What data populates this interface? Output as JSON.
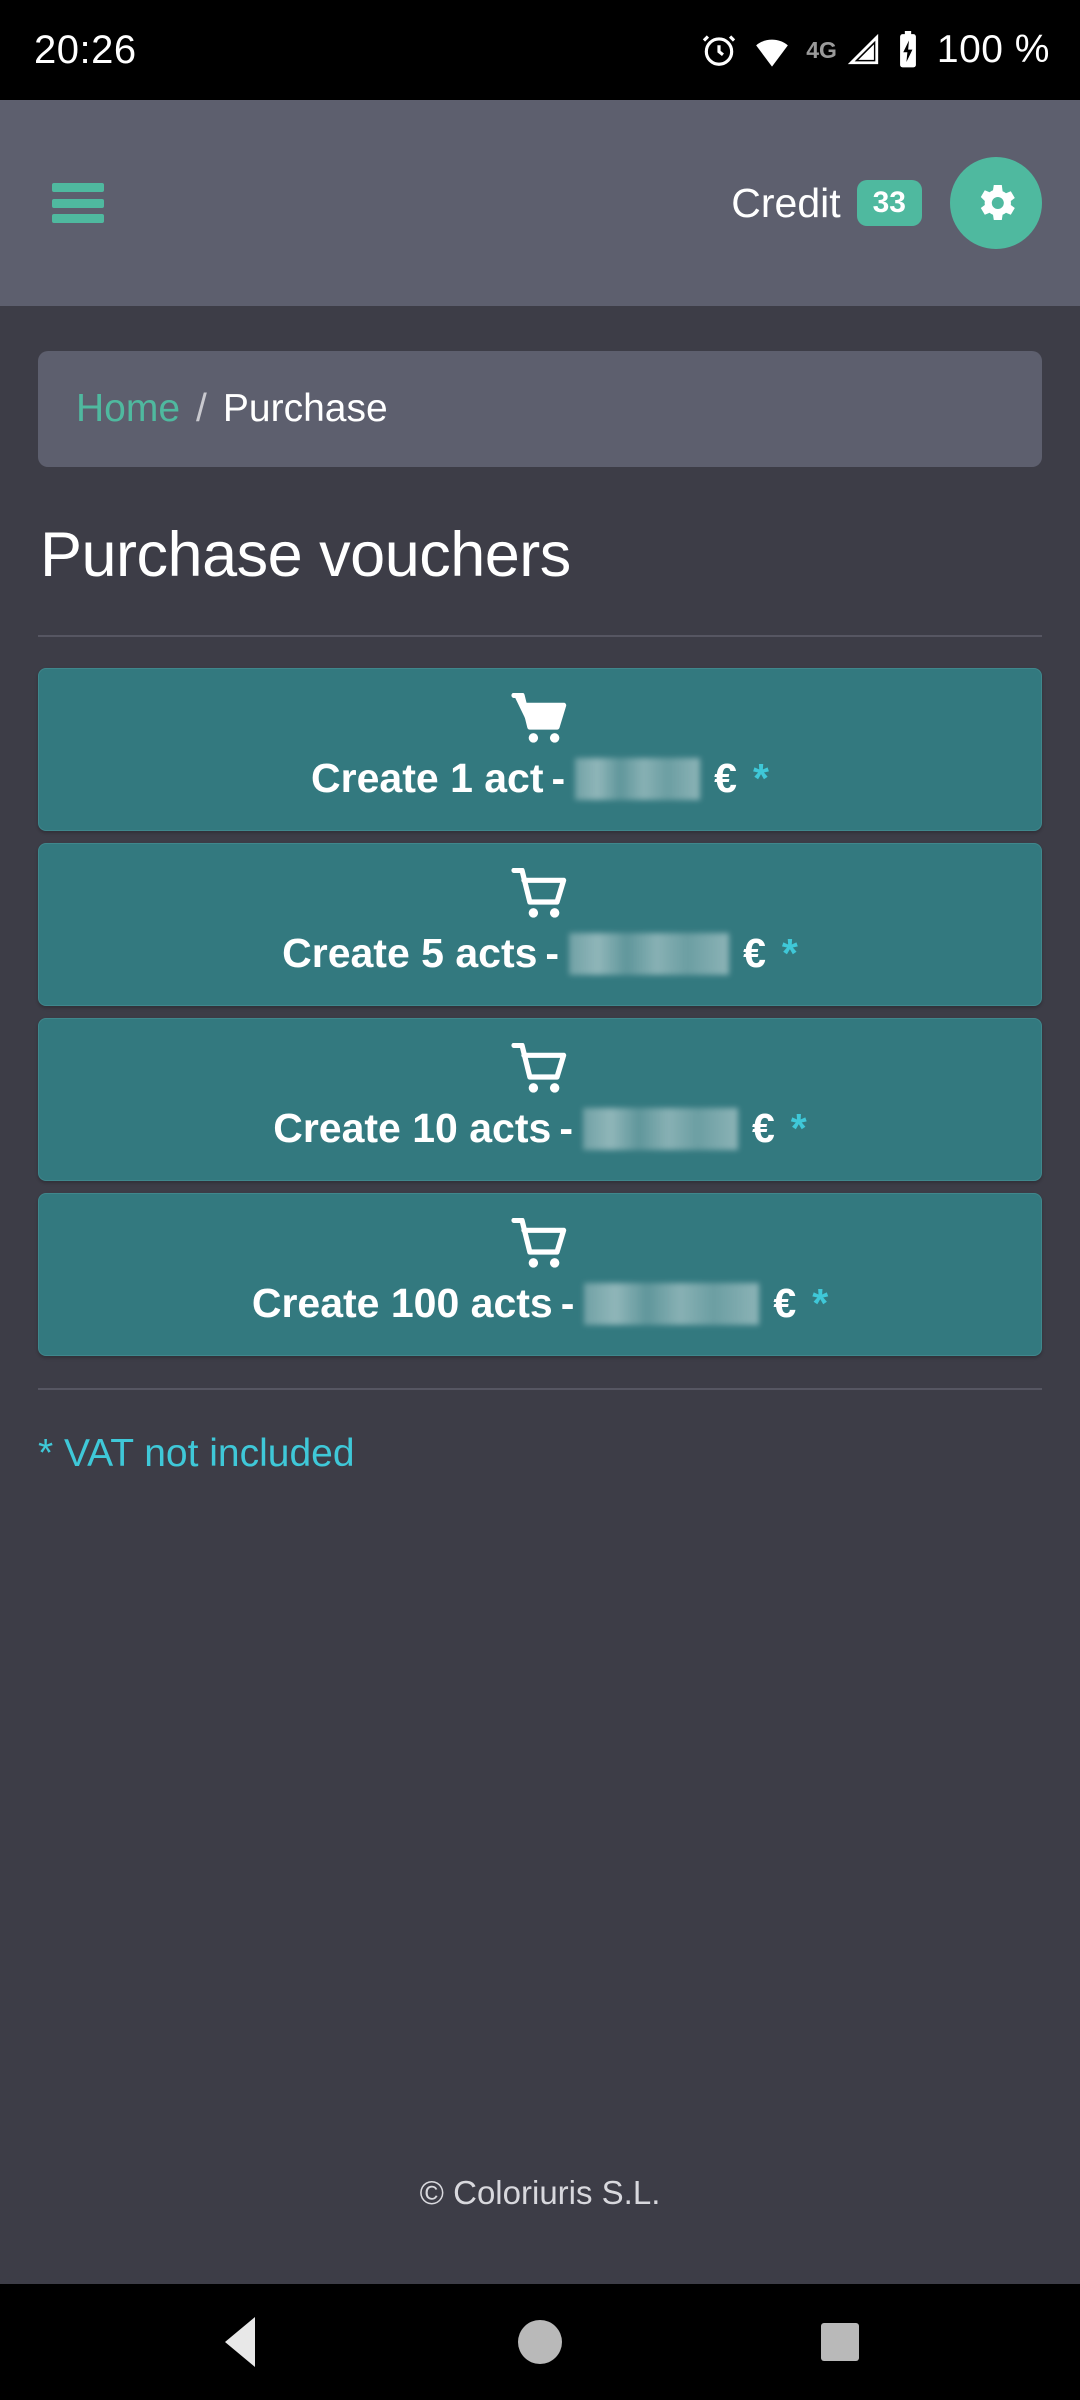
{
  "status_bar": {
    "time": "20:26",
    "network_type": "4G",
    "battery": "100 %",
    "icons": [
      "alarm-icon",
      "wifi-icon",
      "signal-icon",
      "battery-icon"
    ]
  },
  "app_bar": {
    "menu_icon": "hamburger-menu-icon",
    "credit_label": "Credit",
    "credit_value": "33",
    "settings_icon": "gear-icon"
  },
  "breadcrumb": {
    "home": "Home",
    "separator": "/",
    "current": "Purchase"
  },
  "page": {
    "title": "Purchase vouchers"
  },
  "vouchers": [
    {
      "label": "Create 1 act",
      "dash": "-",
      "price": "",
      "price_width": 58,
      "currency": "€",
      "footnote": "*",
      "icon": "shopping-cart-icon"
    },
    {
      "label": "Create 5 acts",
      "dash": "-",
      "price": "",
      "price_width": 92,
      "currency": "€",
      "footnote": "*",
      "icon": "shopping-cart-icon"
    },
    {
      "label": "Create 10 acts",
      "dash": "-",
      "price": "",
      "price_width": 92,
      "currency": "€",
      "footnote": "*",
      "icon": "shopping-cart-icon"
    },
    {
      "label": "Create 100 acts",
      "dash": "-",
      "price": "",
      "price_width": 114,
      "currency": "€",
      "footnote": "*",
      "icon": "shopping-cart-icon"
    }
  ],
  "footer": {
    "vat_note": "* VAT not included",
    "copyright": "© Coloriuris S.L."
  },
  "nav_bar": {
    "back": "back-icon",
    "home": "home-icon",
    "recents": "recents-icon"
  },
  "colors": {
    "accent_green": "#4fb99f",
    "card_teal": "#33797f",
    "cyan_note": "#3fc8d8",
    "header_bg": "#5d5f6e",
    "page_bg": "#3d3d47"
  }
}
